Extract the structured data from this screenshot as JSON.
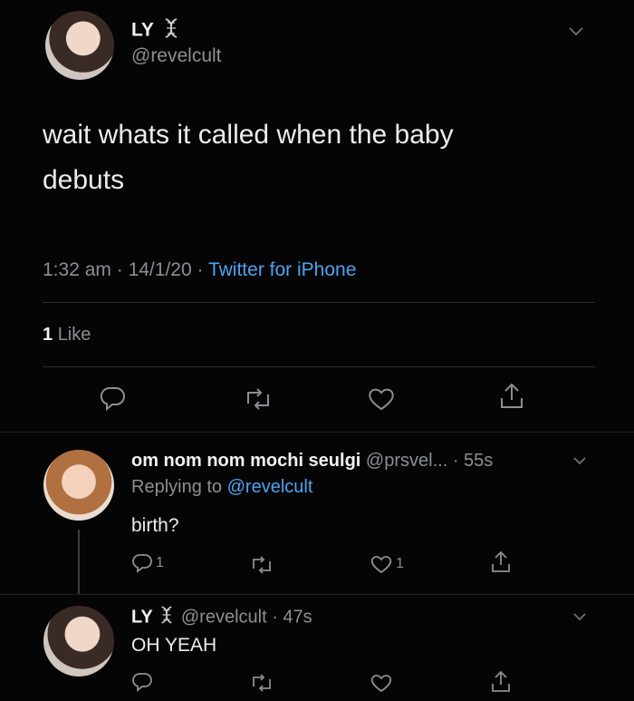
{
  "main_tweet": {
    "display_name": "LY",
    "name_emoji": "dna-emoji",
    "handle": "@revelcult",
    "text_line1": "wait whats it called when the baby",
    "text_line2": "debuts",
    "time": "1:32 am",
    "date": "14/1/20",
    "source": "Twitter for iPhone",
    "sep": "·",
    "likes_count": "1",
    "likes_label": "Like"
  },
  "reply1": {
    "display_name": "om nom nom mochi seulgi",
    "handle": "@prsvel...",
    "time": "· 55s",
    "replying_to_label": "Replying to",
    "replying_to_handle": "@revelcult",
    "text": "birth?",
    "reply_count": "1",
    "like_count": "1"
  },
  "reply2": {
    "display_name": "LY",
    "handle": "@revelcult",
    "time": "· 47s",
    "text": "OH YEAH"
  },
  "colors": {
    "background": "#050505",
    "text": "#e8e8e8",
    "muted": "#8b8f94",
    "link": "#4da3f0"
  },
  "icons": [
    "reply-icon",
    "retweet-icon",
    "like-icon",
    "share-icon",
    "chevron-down-icon",
    "dna-emoji"
  ]
}
